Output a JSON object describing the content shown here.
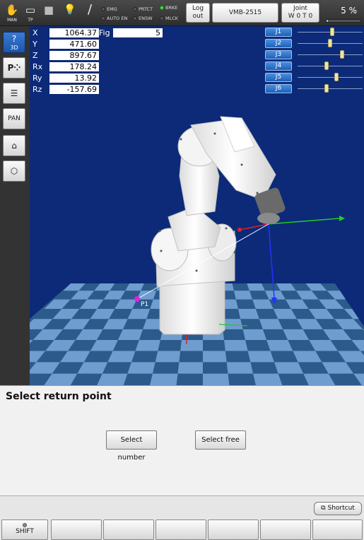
{
  "topbar": {
    "icons": [
      {
        "name": "hand-icon",
        "glyph": "✋",
        "label": "MAN"
      },
      {
        "name": "teach-pendant-icon",
        "glyph": "▭",
        "label": "TP"
      },
      {
        "name": "stop-icon",
        "glyph": "■",
        "label": ""
      },
      {
        "name": "lightbulb-icon",
        "glyph": "💡",
        "label": ""
      },
      {
        "name": "wrench-icon",
        "glyph": "/",
        "label": ""
      }
    ],
    "status": {
      "emg": "EMG",
      "auto_en": "AUTO EN",
      "prtct": "PRTCT",
      "ensw": "ENSW",
      "brke": "BRKE",
      "mlck": "MLCK"
    },
    "logout_label": "Log out",
    "robot_label": "VMB-2515",
    "joint_label": "Joint",
    "tool_label": "W 0 T 0",
    "speed_text": "5 %",
    "speed_fraction": 0.05
  },
  "leftbar": {
    "btn_3d": "3D",
    "btn_pan": "PAN"
  },
  "coords": [
    {
      "key": "X",
      "value": "1064.37"
    },
    {
      "key": "Y",
      "value": "471.60"
    },
    {
      "key": "Z",
      "value": "897.67"
    },
    {
      "key": "Rx",
      "value": "178.24"
    },
    {
      "key": "Ry",
      "value": "13.92"
    },
    {
      "key": "Rz",
      "value": "-157.69"
    }
  ],
  "fig": {
    "key": "Fig",
    "value": "5"
  },
  "joints": [
    {
      "label": "J1",
      "pos": 0.53
    },
    {
      "label": "J2",
      "pos": 0.5
    },
    {
      "label": "J3",
      "pos": 0.68
    },
    {
      "label": "J4",
      "pos": 0.45
    },
    {
      "label": "J5",
      "pos": 0.6
    },
    {
      "label": "J6",
      "pos": 0.45
    }
  ],
  "scene": {
    "point_label": "P1"
  },
  "dialog": {
    "title": "Select return point",
    "btn_number": "Select number",
    "btn_free": "Select free"
  },
  "bottom": {
    "shortcut_label": "Shortcut",
    "keys": [
      "SHIFT",
      "",
      "",
      "",
      "",
      "",
      ""
    ]
  }
}
